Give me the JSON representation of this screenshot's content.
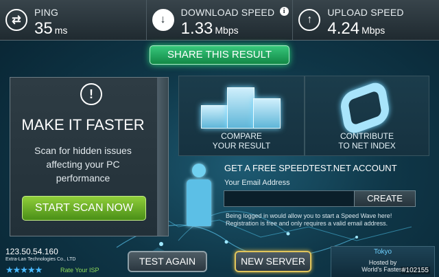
{
  "topbar": {
    "ping": {
      "label": "PING",
      "value": "35",
      "unit": "ms",
      "icon": "exchange-arrows-icon"
    },
    "download": {
      "label": "DOWNLOAD SPEED",
      "value": "1.33",
      "unit": "Mbps",
      "icon": "arrow-down-icon"
    },
    "upload": {
      "label": "UPLOAD SPEED",
      "value": "4.24",
      "unit": "Mbps",
      "icon": "arrow-up-icon"
    },
    "info_glyph": "i"
  },
  "share": {
    "label": "SHARE THIS RESULT"
  },
  "make_faster": {
    "alert_glyph": "!",
    "title": "MAKE IT FASTER",
    "description": "Scan for hidden issues affecting your PC performance",
    "button": "START SCAN NOW"
  },
  "compare": {
    "label_line1": "COMPARE",
    "label_line2": "YOUR RESULT"
  },
  "contribute": {
    "label_line1": "CONTRIBUTE",
    "label_line2": "TO NET INDEX"
  },
  "account": {
    "title": "GET A FREE SPEEDTEST.NET ACCOUNT",
    "email_label": "Your Email Address",
    "email_value": "",
    "create_button": "CREATE",
    "note": "Being logged in would allow you to start a Speed Wave here! Registration is free and only requires a valid email address."
  },
  "client": {
    "ip": "123.50.54.160",
    "isp": "Extra-Lan Technologies Co., LTD",
    "rating_stars": "★★★★★",
    "rate_label": "Rate Your ISP"
  },
  "buttons": {
    "test_again": "TEST AGAIN",
    "new_server": "NEW SERVER"
  },
  "server": {
    "city": "Tokyo",
    "hosted_line1": "Hosted by",
    "hosted_line2": "World's Fastest"
  },
  "watermark": "#102155",
  "colors": {
    "accent_green": "#2bd77b",
    "accent_blue": "#74d7ff",
    "server_gold": "#d8b84a"
  }
}
